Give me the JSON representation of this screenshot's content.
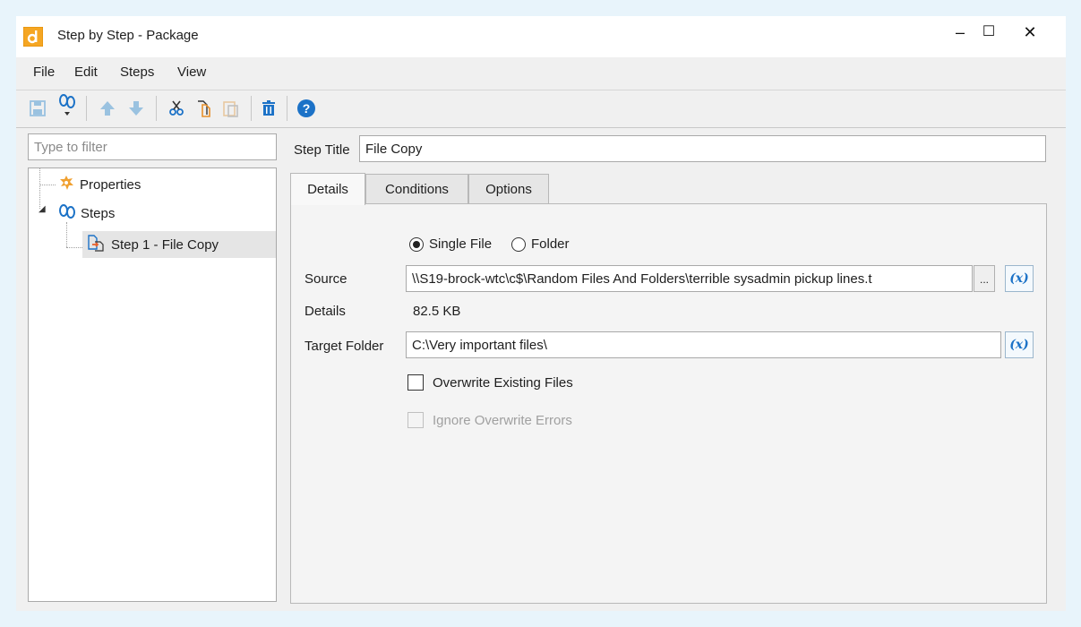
{
  "window": {
    "title": "Step by Step - Package",
    "controls": {
      "minimize": "–",
      "maximize": "☐",
      "close": "✕"
    }
  },
  "menu": [
    "File",
    "Edit",
    "Steps",
    "View"
  ],
  "toolbar": {
    "icons": [
      "save-icon",
      "add-step-icon",
      "move-up-icon",
      "move-down-icon",
      "cut-icon",
      "copy-icon",
      "paste-icon",
      "delete-icon",
      "help-icon"
    ]
  },
  "filter": {
    "placeholder": "Type to filter",
    "value": ""
  },
  "tree": {
    "properties": "Properties",
    "steps": "Steps",
    "step1": "Step 1 - File Copy"
  },
  "step_title": {
    "label": "Step Title",
    "value": "File Copy"
  },
  "tabs": [
    "Details",
    "Conditions",
    "Options"
  ],
  "details": {
    "radio_single": "Single File",
    "radio_folder": "Folder",
    "selected_mode": "Single File",
    "source_label": "Source",
    "source_value": "\\\\S19-brock-wtc\\c$\\Random Files And Folders\\terrible sysadmin pickup lines.t",
    "browse_label": "...",
    "var_label": "(x)",
    "details_label": "Details",
    "details_value": "82.5 KB",
    "target_label": "Target Folder",
    "target_value": "C:\\Very important files\\",
    "overwrite_label": "Overwrite Existing Files",
    "overwrite_checked": false,
    "ignore_label": "Ignore Overwrite Errors",
    "ignore_checked": false,
    "ignore_disabled": true
  },
  "colors": {
    "accent_blue": "#1c72c7",
    "icon_orange": "#f0a030",
    "background": "#f0f0f0"
  }
}
